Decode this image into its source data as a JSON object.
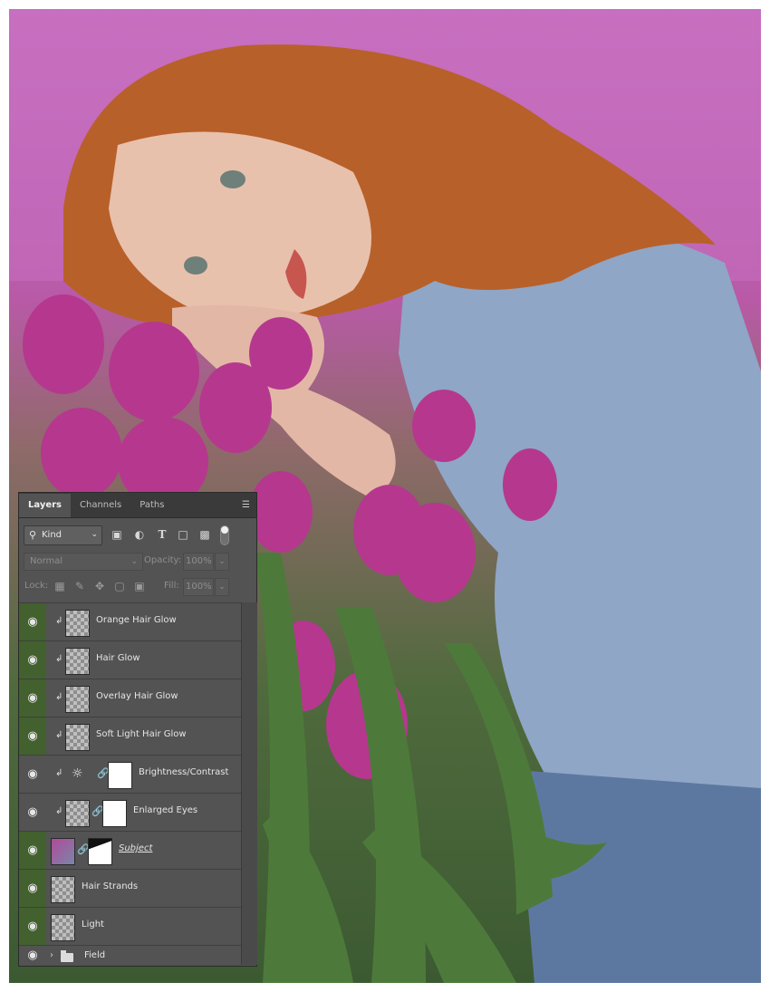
{
  "panel": {
    "tabs": [
      {
        "label": "Layers",
        "active": true
      },
      {
        "label": "Channels",
        "active": false
      },
      {
        "label": "Paths",
        "active": false
      }
    ],
    "menu_icon": "panel-menu-icon",
    "filter": {
      "kind_label": "Kind",
      "icons": [
        "pixel-filter-icon",
        "adjustment-filter-icon",
        "type-filter-icon",
        "shape-filter-icon",
        "smart-object-filter-icon"
      ]
    },
    "blend_mode": "Normal",
    "opacity_label": "Opacity:",
    "opacity_value": "100%",
    "lock_label": "Lock:",
    "fill_label": "Fill:",
    "fill_value": "100%",
    "layers": [
      {
        "name": "Orange Hair Glow",
        "clipped": true,
        "eye_highlight": true
      },
      {
        "name": "Hair Glow",
        "clipped": true,
        "eye_highlight": true
      },
      {
        "name": "Overlay Hair Glow",
        "clipped": true,
        "eye_highlight": true
      },
      {
        "name": "Soft Light  Hair Glow",
        "clipped": true,
        "eye_highlight": true
      },
      {
        "name": "Brightness/Contrast",
        "clipped": true,
        "eye_highlight": false
      },
      {
        "name": "Enlarged Eyes",
        "clipped": true,
        "eye_highlight": false
      },
      {
        "name": "Subject",
        "clipped": false,
        "eye_highlight": true
      },
      {
        "name": "Hair Strands",
        "clipped": false,
        "eye_highlight": true
      },
      {
        "name": "Light",
        "clipped": false,
        "eye_highlight": true
      },
      {
        "name": "Field",
        "clipped": false,
        "eye_highlight": false
      }
    ]
  }
}
